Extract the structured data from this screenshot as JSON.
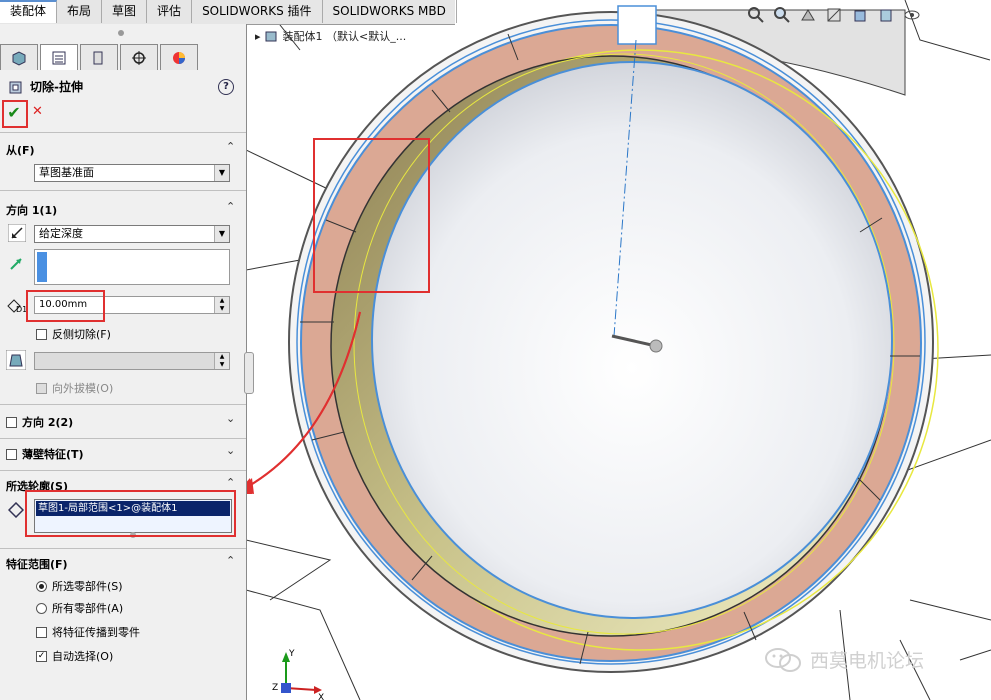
{
  "tabs": [
    "装配体",
    "布局",
    "草图",
    "评估",
    "SOLIDWORKS 插件",
    "SOLIDWORKS MBD"
  ],
  "active_tab": "装配体",
  "view_toolbar_icons": [
    "zoom-fit-icon",
    "zoom-area-icon",
    "previous-view-icon",
    "section-view-icon",
    "view-orientation-icon",
    "display-style-icon",
    "hide-show-icon"
  ],
  "tree": {
    "label": "装配体1 （默认<默认_..."
  },
  "panel": {
    "tab_icons": [
      "feature-manager-icon",
      "property-manager-icon",
      "configuration-manager-icon",
      "dimxpert-icon",
      "display-manager-icon"
    ],
    "title": "切除-拉伸",
    "help": "?",
    "ok": "✔",
    "cancel": "✕",
    "from": {
      "header": "从(F)",
      "value": "草图基准面"
    },
    "direction1": {
      "header": "方向 1(1)",
      "end_condition": "给定深度",
      "depth": "10.00mm",
      "depth_label": "D1",
      "flip_side": "反侧切除(F)",
      "draft_outward": "向外拔模(O)"
    },
    "direction2": {
      "header": "方向 2(2)"
    },
    "thin_feature": {
      "header": "薄壁特征(T)"
    },
    "selected_contours": {
      "header": "所选轮廓(S)",
      "items": [
        "草图1-局部范围<1>@装配体1"
      ]
    },
    "feature_scope": {
      "header": "特征范围(F)",
      "opt1": "所选零部件(S)",
      "opt2": "所有零部件(A)",
      "propagate": "将特征传播到零件",
      "auto_select": "自动选择(O)"
    }
  },
  "watermark": "西莫电机论坛",
  "colors": {
    "annotation": "#e03030",
    "ring_fill": "#dba894",
    "edge_blue": "#4a8fd8",
    "yellow": "#e8e840"
  }
}
